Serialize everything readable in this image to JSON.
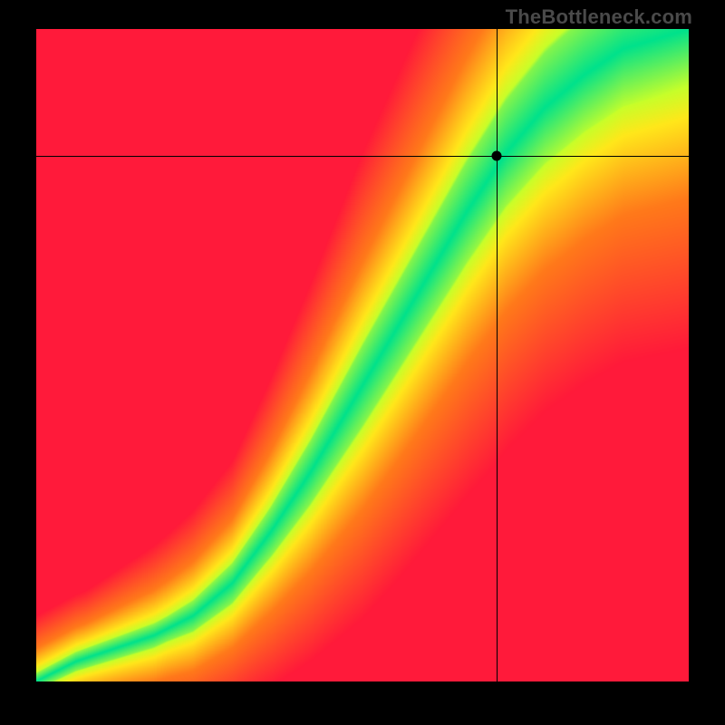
{
  "watermark": "TheBottleneck.com",
  "colors": {
    "red": "#ff1a3a",
    "orange": "#ff7a1a",
    "yellow": "#ffe81a",
    "yellowgreen": "#c8ff2a",
    "green": "#00e28c",
    "black": "#000000"
  },
  "chart_data": {
    "type": "heatmap",
    "title": "",
    "xlabel": "",
    "ylabel": "",
    "xlim": [
      0,
      100
    ],
    "ylim": [
      0,
      100
    ],
    "marker": {
      "x": 70.5,
      "y": 80.5
    },
    "crosshair": {
      "x": 70.5,
      "y": 80.5
    },
    "ridge": [
      {
        "x": 0,
        "y": 0
      },
      {
        "x": 6,
        "y": 3
      },
      {
        "x": 12,
        "y": 5
      },
      {
        "x": 18,
        "y": 7
      },
      {
        "x": 24,
        "y": 10
      },
      {
        "x": 30,
        "y": 15
      },
      {
        "x": 36,
        "y": 23
      },
      {
        "x": 42,
        "y": 32
      },
      {
        "x": 48,
        "y": 42
      },
      {
        "x": 54,
        "y": 52
      },
      {
        "x": 60,
        "y": 62
      },
      {
        "x": 66,
        "y": 72
      },
      {
        "x": 72,
        "y": 81
      },
      {
        "x": 78,
        "y": 88
      },
      {
        "x": 84,
        "y": 93
      },
      {
        "x": 90,
        "y": 97
      },
      {
        "x": 100,
        "y": 100
      }
    ],
    "ridge_width": [
      {
        "x": 0,
        "w": 1.2
      },
      {
        "x": 20,
        "w": 1.8
      },
      {
        "x": 35,
        "w": 3.5
      },
      {
        "x": 50,
        "w": 6.0
      },
      {
        "x": 65,
        "w": 7.5
      },
      {
        "x": 80,
        "w": 8.5
      },
      {
        "x": 100,
        "w": 9.0
      }
    ],
    "yellow_band": [
      {
        "x": 0,
        "w": 3
      },
      {
        "x": 30,
        "w": 7
      },
      {
        "x": 50,
        "w": 13
      },
      {
        "x": 70,
        "w": 17
      },
      {
        "x": 100,
        "w": 20
      }
    ],
    "legend": [],
    "annotations": []
  }
}
